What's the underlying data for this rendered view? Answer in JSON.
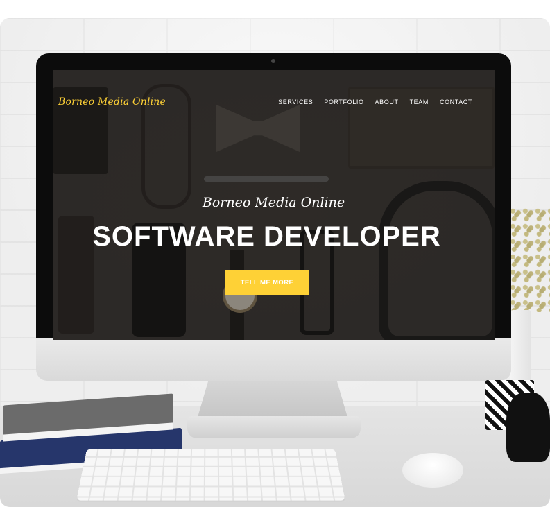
{
  "website": {
    "brand": "Borneo Media Online",
    "nav": {
      "items": [
        {
          "label": "SERVICES"
        },
        {
          "label": "PORTFOLIO"
        },
        {
          "label": "ABOUT"
        },
        {
          "label": "TEAM"
        },
        {
          "label": "CONTACT"
        }
      ]
    },
    "hero": {
      "subtitle": "Borneo Media Online",
      "title": "SOFTWARE DEVELOPER",
      "cta_label": "TELL ME MORE"
    }
  },
  "colors": {
    "accent": "#fed136",
    "nav_text": "#ffffff",
    "hero_background": "#3d3a37"
  },
  "icons": {
    "webcam": "camera-icon"
  }
}
